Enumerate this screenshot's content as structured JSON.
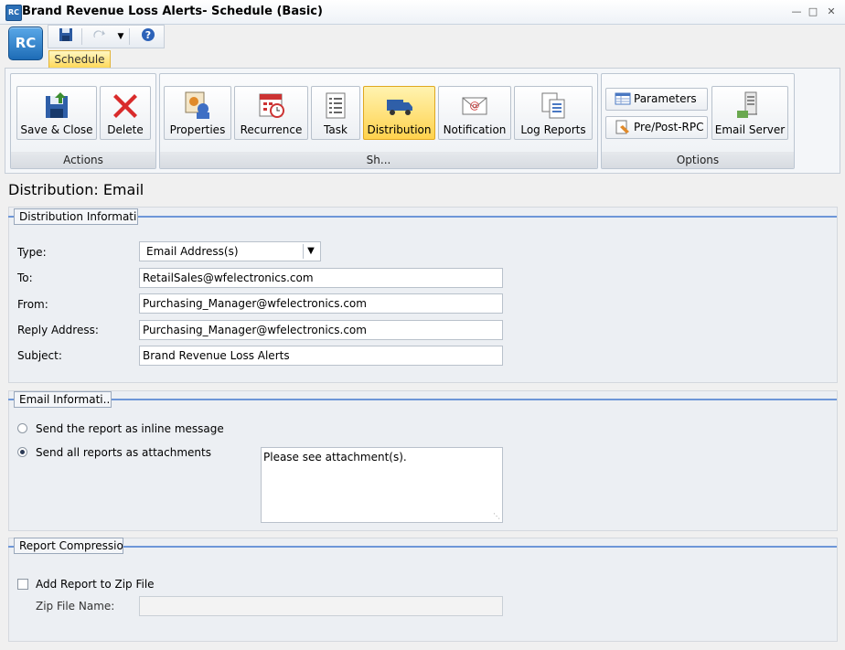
{
  "window": {
    "icon_text": "RC",
    "title": "Brand Revenue Loss Alerts- Schedule (Basic)"
  },
  "app_logo": "RC",
  "ribbon_tab": "Schedule",
  "ribbon": {
    "actions": {
      "label": "Actions",
      "save_close": "Save & Close",
      "delete": "Delete"
    },
    "schedule": {
      "label": "Sh...",
      "properties": "Properties",
      "recurrence": "Recurrence",
      "task": "Task",
      "distribution": "Distribution",
      "notification": "Notification",
      "log_reports": "Log Reports"
    },
    "options": {
      "label": "Options",
      "parameters": "Parameters",
      "pre_post": "Pre/Post-RPC",
      "email_server": "Email Server"
    }
  },
  "heading": "Distribution: Email",
  "distribution_info": {
    "section_title": "Distribution Informati...",
    "type_label": "Type:",
    "type_value": "Email Address(s)",
    "to_label": "To:",
    "to_value": "RetailSales@wfelectronics.com",
    "from_label": "From:",
    "from_value": "Purchasing_Manager@wfelectronics.com",
    "reply_label": "Reply Address:",
    "reply_value": "Purchasing_Manager@wfelectronics.com",
    "subject_label": "Subject:",
    "subject_value": "Brand Revenue Loss Alerts"
  },
  "email_info": {
    "section_title": "Email Informati...",
    "inline_option": "Send the report as inline message",
    "attach_option": "Send all reports as attachments",
    "message_body": "Please see attachment(s)."
  },
  "compression": {
    "section_title": "Report Compression",
    "zip_checkbox_label": "Add Report to Zip File",
    "zip_name_label": "Zip File Name:",
    "zip_name_value": ""
  },
  "colors": {
    "accent_blue": "#6d96d8",
    "active_button": "#ffd24d",
    "tab_highlight": "#ffd95a"
  }
}
